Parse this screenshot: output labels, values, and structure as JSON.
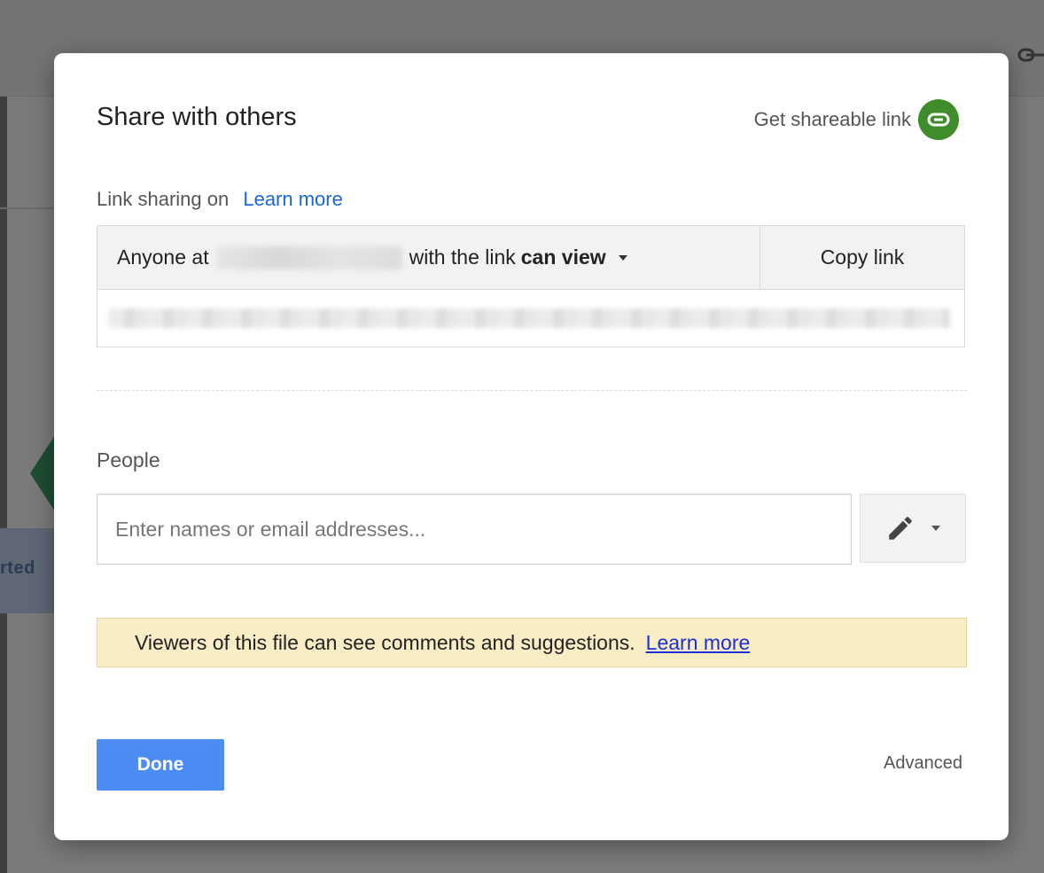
{
  "background": {
    "tile_text": "rted"
  },
  "dialog": {
    "title": "Share with others",
    "get_link_label": "Get shareable link",
    "link_sharing": {
      "status": "Link sharing on",
      "learn_more": "Learn more",
      "access_prefix": "Anyone at",
      "access_middle": "with the link",
      "access_level": "can view",
      "copy_link": "Copy link"
    },
    "people": {
      "label": "People",
      "placeholder": "Enter names or email addresses..."
    },
    "notice": {
      "text": "Viewers of this file can see comments and suggestions.",
      "link": "Learn more"
    },
    "footer": {
      "done": "Done",
      "advanced": "Advanced"
    },
    "colors": {
      "accent_green": "#3e8c2a",
      "done_blue": "#4d8cf2",
      "link_blue": "#1a66d6",
      "notice_bg": "#f9edc6"
    }
  }
}
